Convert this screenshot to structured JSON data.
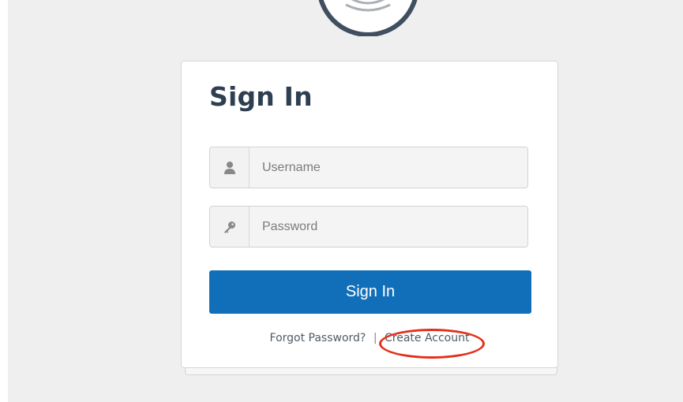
{
  "card": {
    "title": "Sign In"
  },
  "form": {
    "username_placeholder": "Username",
    "password_placeholder": "Password",
    "submit_label": "Sign In"
  },
  "links": {
    "forgot_password": "Forgot Password?",
    "separator": "|",
    "create_account": "Create Account"
  },
  "icons": {
    "username": "user-icon",
    "password": "key-icon",
    "logo": "broadcast-logo-icon"
  },
  "colors": {
    "primary_button": "#116fb9",
    "title_text": "#2e3f52",
    "annotation_highlight": "#e3301a",
    "background": "#efefef"
  }
}
